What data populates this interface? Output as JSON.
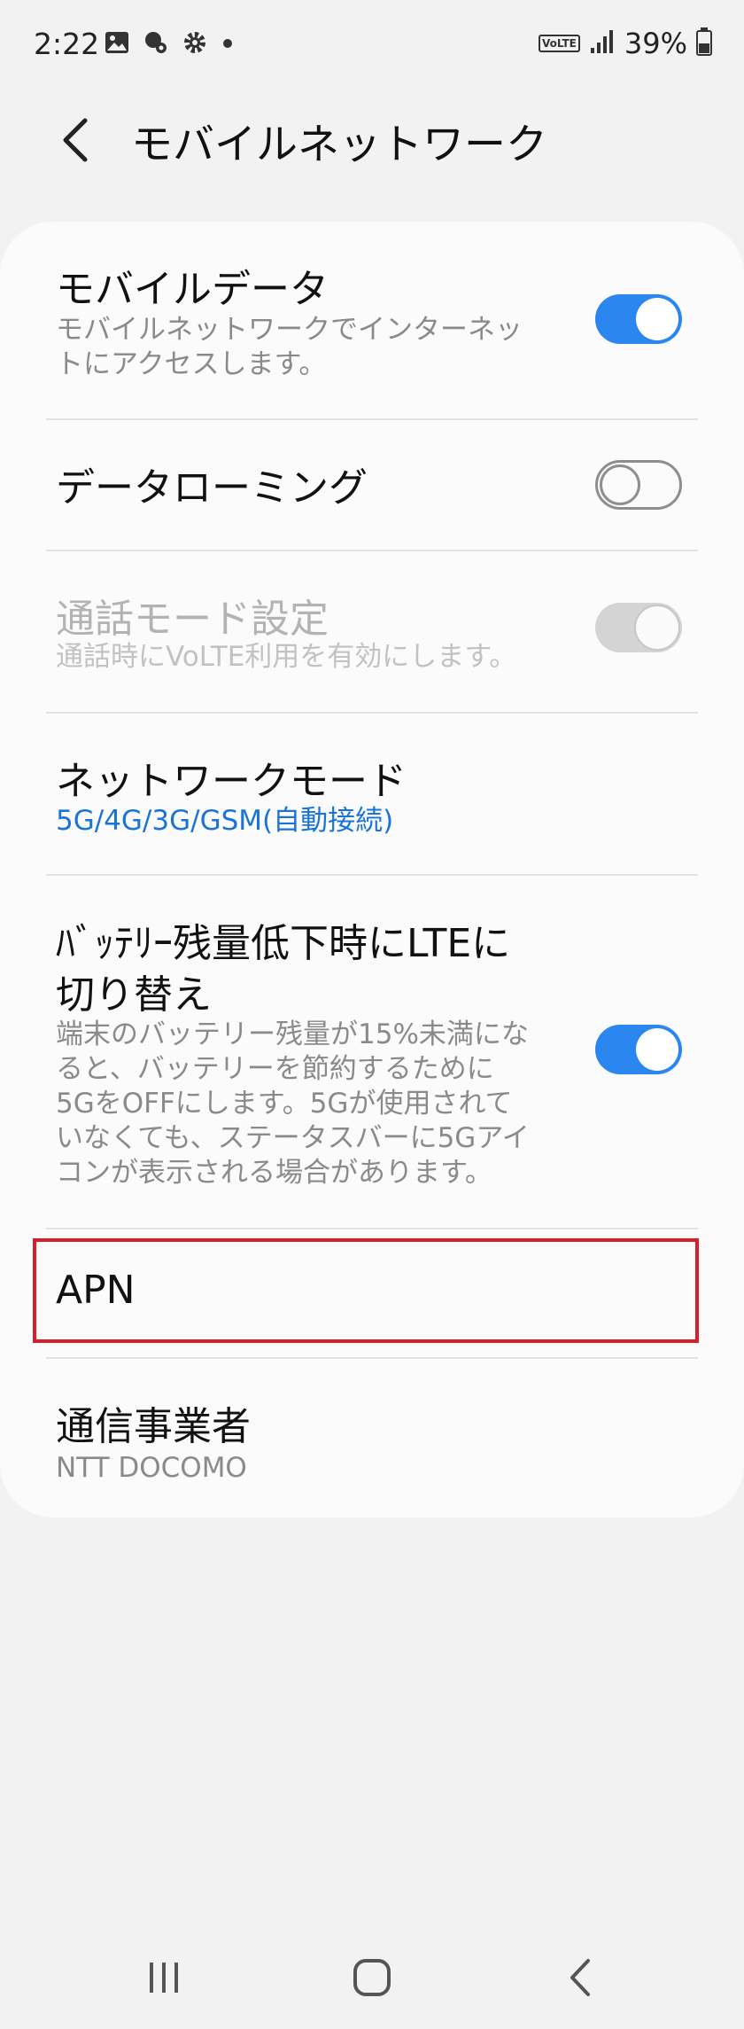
{
  "status_bar": {
    "time": "2:22",
    "volte": "VoLTE",
    "battery": "39%",
    "icons": [
      "image-icon",
      "bubble-gear-icon",
      "settings-icon",
      "dot-icon",
      "volte-icon",
      "signal-icon",
      "battery-icon"
    ]
  },
  "header": {
    "title": "モバイルネットワーク"
  },
  "settings": {
    "mobile_data": {
      "title": "モバイルデータ",
      "sub1": "モバイルネットワークでインターネッ",
      "sub2": "トにアクセスします。",
      "enabled": true
    },
    "roaming": {
      "title": "データローミング",
      "enabled": false
    },
    "call_mode": {
      "title": "通話モード設定",
      "sub": "通話時にVoLTE利用を有効にします。",
      "enabled": true,
      "disabled": true
    },
    "network_mode": {
      "title": "ネットワークモード",
      "value": "5G/4G/3G/GSM(自動接続)"
    },
    "battery_lte": {
      "title1": "ﾊﾞｯﾃﾘｰ残量低下時にLTEに",
      "title2": "切り替え",
      "sub1": "端末のバッテリー残量が15%未満にな",
      "sub2": "ると、バッテリーを節約するために",
      "sub3": "5GをOFFにします。5Gが使用されて",
      "sub4": "いなくても、ステータスバーに5Gアイ",
      "sub5": "コンが表示される場合があります。",
      "enabled": true
    },
    "apn": {
      "title": "APN"
    },
    "carrier": {
      "title": "通信事業者",
      "value": "NTT DOCOMO"
    }
  },
  "colors": {
    "accent": "#2b87ef",
    "highlight": "#d81e2e",
    "link": "#1a73d9"
  }
}
